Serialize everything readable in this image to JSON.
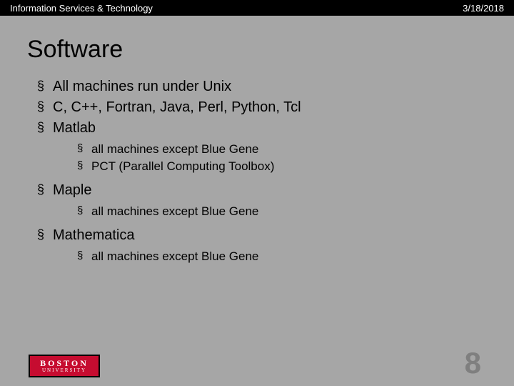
{
  "header": {
    "org": "Information Services & Technology",
    "date": "3/18/2018"
  },
  "title": "Software",
  "bullets": [
    {
      "text": "All machines run under Unix"
    },
    {
      "text": "C, C++, Fortran, Java, Perl, Python, Tcl"
    },
    {
      "text": "Matlab",
      "sub": [
        "all machines except Blue Gene",
        "PCT (Parallel Computing Toolbox)"
      ]
    },
    {
      "text": "Maple",
      "sub": [
        "all machines except Blue Gene"
      ]
    },
    {
      "text": "Mathematica",
      "sub": [
        "all machines except Blue Gene"
      ]
    }
  ],
  "logo": {
    "line1": "BOSTON",
    "line2": "UNIVERSITY"
  },
  "page_number": "8"
}
